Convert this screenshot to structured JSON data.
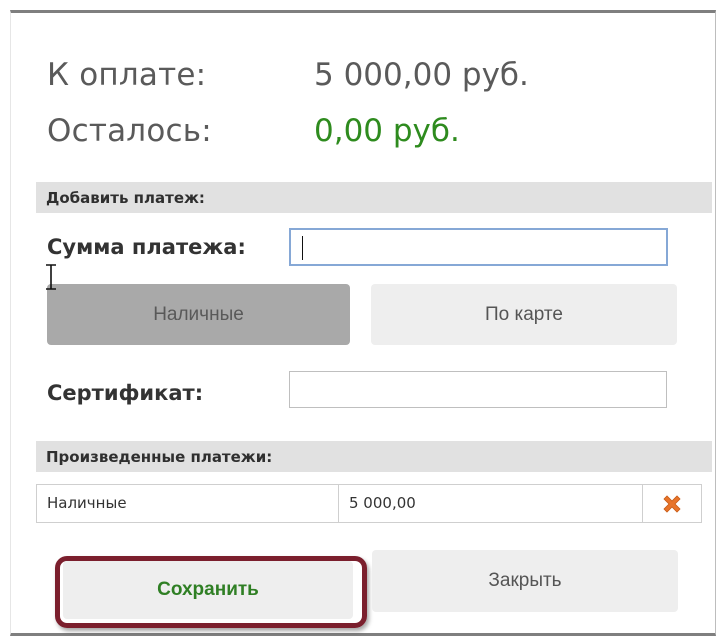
{
  "summary": {
    "to_pay_label": "К оплате:",
    "to_pay_value": "5 000,00 руб.",
    "remaining_label": "Осталось:",
    "remaining_value": "0,00 руб."
  },
  "add_payment": {
    "section_title": "Добавить платеж:",
    "amount_label": "Сумма платежа:",
    "amount_value": "",
    "cash_button": "Наличные",
    "card_button": "По карте",
    "certificate_label": "Сертификат:",
    "certificate_value": ""
  },
  "payments": {
    "section_title": "Произведенные платежи:",
    "rows": [
      {
        "method": "Наличные",
        "amount": "5 000,00"
      }
    ]
  },
  "actions": {
    "save_label": "Сохранить",
    "close_label": "Закрыть"
  },
  "colors": {
    "remaining_value": "#2e8b1e",
    "save_text": "#2f7f24",
    "highlight_ring": "#7b1f2d",
    "delete_icon": "#e8742a",
    "active_button": "#a9a9a9"
  },
  "icons": {
    "delete": "close-x-icon",
    "cursor": "text-cursor-icon"
  }
}
